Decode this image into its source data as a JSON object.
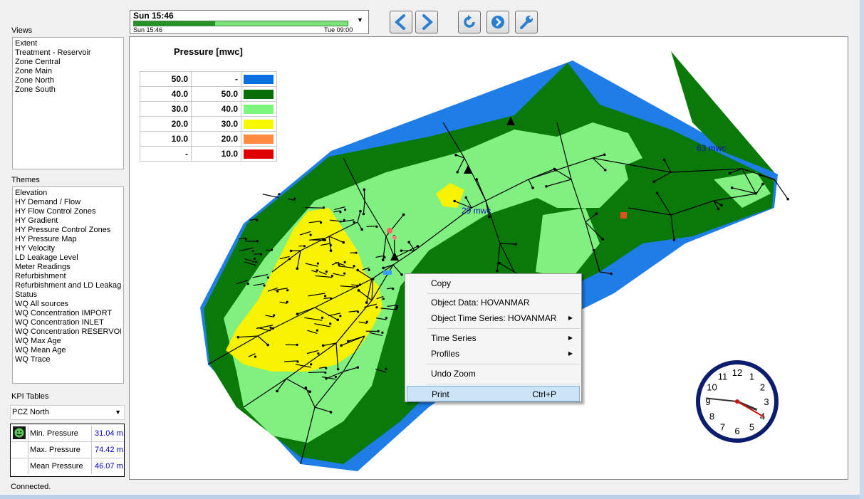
{
  "timebar": {
    "current": "Sun 15:46",
    "start": "Sun 15:46",
    "end": "Tue 09:00",
    "progress": 0.38
  },
  "toolbar": {
    "back_icon": "chevron-left-icon",
    "forward_icon": "chevron-right-icon",
    "refresh_icon": "refresh-icon",
    "go_icon": "arrow-circle-icon",
    "settings_icon": "wrench-icon"
  },
  "views": {
    "label": "Views",
    "items": [
      "Extent",
      "Treatment - Reservoir",
      "Zone Central",
      "Zone Main",
      "Zone North",
      "Zone South"
    ]
  },
  "themes": {
    "label": "Themes",
    "items": [
      "Elevation",
      "HY Demand / Flow",
      "HY Flow Control Zones",
      "HY Gradient",
      "HY Pressure Control Zones",
      "HY Pressure Map",
      "HY Velocity",
      "LD Leakage Level",
      "Meter Readings",
      "Refurbishment",
      "Refurbishment and LD Leakage",
      "Status",
      "WQ All sources",
      "WQ Concentration IMPORT",
      "WQ Concentration INLET",
      "WQ Concentration RESERVOIR",
      "WQ Max Age",
      "WQ Mean Age",
      "WQ Trace"
    ]
  },
  "kpi": {
    "label": "KPI Tables",
    "selected": "PCZ North",
    "rows": [
      {
        "label": "Min. Pressure",
        "value": "31.04 m..."
      },
      {
        "label": "Max. Pressure",
        "value": "74.42 m..."
      },
      {
        "label": "Mean Pressure",
        "value": "46.07 m..."
      }
    ],
    "status_icon": "smiley-ok-icon"
  },
  "legend": {
    "title": "Pressure [mwc]",
    "rows": [
      {
        "from": "50.0",
        "to": "-",
        "color": "#0a6fdf"
      },
      {
        "from": "40.0",
        "to": "50.0",
        "color": "#067006"
      },
      {
        "from": "30.0",
        "to": "40.0",
        "color": "#7cf67c"
      },
      {
        "from": "20.0",
        "to": "30.0",
        "color": "#f8f800"
      },
      {
        "from": "10.0",
        "to": "20.0",
        "color": "#ff8c40"
      },
      {
        "from": "-",
        "to": "10.0",
        "color": "#e00000"
      }
    ]
  },
  "map": {
    "annotations": [
      "63 mwc",
      "29 mwc"
    ],
    "colors": {
      "blue": "#1f7de8",
      "dark_green": "#097a09",
      "light_green": "#80f080",
      "yellow": "#f6f200",
      "network": "#000000"
    }
  },
  "context_menu": {
    "items": [
      {
        "label": "Copy",
        "submenu": false,
        "shortcut": ""
      },
      {
        "label": "Object Data: HOVANMAR",
        "submenu": false,
        "shortcut": ""
      },
      {
        "label": "Object Time Series: HOVANMAR",
        "submenu": true,
        "shortcut": ""
      },
      {
        "label": "Time Series",
        "submenu": true,
        "shortcut": ""
      },
      {
        "label": "Profiles",
        "submenu": true,
        "shortcut": ""
      },
      {
        "label": "Undo Zoom",
        "submenu": false,
        "shortcut": ""
      },
      {
        "label": "Print",
        "submenu": false,
        "shortcut": "Ctrl+P",
        "highlighted": true
      }
    ]
  },
  "clock": {
    "numbers": [
      "12",
      "1",
      "2",
      "3",
      "4",
      "5",
      "6",
      "7",
      "8",
      "9",
      "10",
      "11"
    ],
    "hour": 3,
    "minute": 46,
    "second": 20
  },
  "status": {
    "text": "Connected."
  }
}
